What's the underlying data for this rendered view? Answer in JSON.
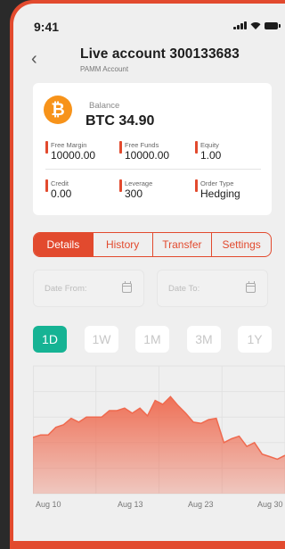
{
  "status_bar": {
    "time": "9:41",
    "signal_icon": "signal-icon",
    "wifi_icon": "wifi-icon",
    "battery_icon": "battery-icon"
  },
  "header": {
    "back_icon": "chevron-left-icon",
    "back_glyph": "‹",
    "title": "Live account 300133683",
    "subtitle": "PAMM Account"
  },
  "balance_card": {
    "coin_icon": "bitcoin-icon",
    "coin_glyph": "₿",
    "balance_label": "Balance",
    "balance_value": "BTC 34.90",
    "stats": [
      {
        "label": "Free Margin",
        "value": "10000.00"
      },
      {
        "label": "Free Funds",
        "value": "10000.00"
      },
      {
        "label": "Equity",
        "value": "1.00"
      },
      {
        "label": "Credit",
        "value": "0.00"
      },
      {
        "label": "Leverage",
        "value": "300"
      },
      {
        "label": "Order Type",
        "value": "Hedging"
      }
    ]
  },
  "tabs": [
    {
      "label": "Details",
      "active": true
    },
    {
      "label": "History",
      "active": false
    },
    {
      "label": "Transfer",
      "active": false
    },
    {
      "label": "Settings",
      "active": false
    }
  ],
  "date_filter": {
    "from_placeholder": "Date From:",
    "to_placeholder": "Date To:",
    "calendar_icon": "calendar-icon"
  },
  "ranges": [
    {
      "label": "1D",
      "active": true
    },
    {
      "label": "1W",
      "active": false
    },
    {
      "label": "1M",
      "active": false
    },
    {
      "label": "3M",
      "active": false
    },
    {
      "label": "1Y",
      "active": false
    }
  ],
  "colors": {
    "accent": "#e24a2e",
    "active_range": "#16b394",
    "background": "#efefef"
  },
  "chart_data": {
    "type": "area",
    "x_tick_labels": [
      "Aug 10",
      "Aug 13",
      "Aug 23",
      "Aug 30"
    ],
    "values": [
      0.44,
      0.46,
      0.46,
      0.52,
      0.54,
      0.59,
      0.56,
      0.6,
      0.6,
      0.6,
      0.65,
      0.65,
      0.67,
      0.63,
      0.67,
      0.61,
      0.73,
      0.7,
      0.76,
      0.69,
      0.63,
      0.56,
      0.55,
      0.58,
      0.59,
      0.4,
      0.43,
      0.45,
      0.37,
      0.4,
      0.31,
      0.29,
      0.27,
      0.3
    ],
    "ylim": [
      0,
      1
    ],
    "grid": true,
    "color": "#ef6a4f"
  }
}
